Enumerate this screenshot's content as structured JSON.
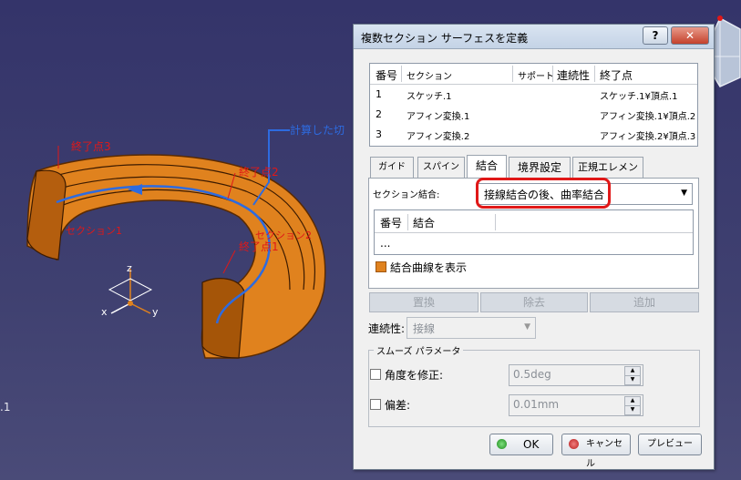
{
  "viewport": {
    "labels": {
      "end3": "終了点3",
      "end2": "終了点2",
      "end1": "終了点1",
      "section2": "セクション2",
      "calc": "計算した切",
      "section1": "セクション1",
      "mark": ".1"
    },
    "axis": {
      "x": "x",
      "y": "y",
      "z": "z"
    }
  },
  "dialog": {
    "title": "複数セクション サーフェスを定義",
    "help": "?",
    "close": "✕",
    "list": {
      "headers": [
        "番号",
        "セクション",
        "サポート",
        "連続性",
        "終了点"
      ],
      "rows": [
        [
          "1",
          "スケッチ.1",
          "",
          "",
          "スケッチ.1¥頂点.1"
        ],
        [
          "2",
          "アフィン変換.1",
          "",
          "",
          "アフィン変換.1¥頂点.2"
        ],
        [
          "3",
          "アフィン変換.2",
          "",
          "",
          "アフィン変換.2¥頂点.3"
        ]
      ]
    },
    "tabs": [
      "ガイド",
      "スパイン",
      "結合",
      "境界設定",
      "正規エレメント"
    ],
    "active_tab": "結合",
    "coupling": {
      "label": "セクション結合:",
      "value": "接線結合の後、曲率結合",
      "list_headers": [
        "番号",
        "結合"
      ],
      "list_rows": [
        "..."
      ],
      "show_curves": "結合曲線を表示"
    },
    "buttons": {
      "replace": "置換",
      "remove": "除去",
      "add": "追加"
    },
    "continuity": {
      "label": "連続性:",
      "value": "接線"
    },
    "smooth": {
      "legend": "スムーズ パラメータ",
      "angle_label": "角度を修正:",
      "angle_value": "0.5deg",
      "deviation_label": "偏差:",
      "deviation_value": "0.01mm"
    },
    "footer": {
      "ok": "OK",
      "cancel": "キャンセル",
      "preview": "プレビュー"
    }
  },
  "colors": {
    "accent": "#e01818",
    "surface": "#e0821e",
    "guide": "#2d6be0"
  }
}
